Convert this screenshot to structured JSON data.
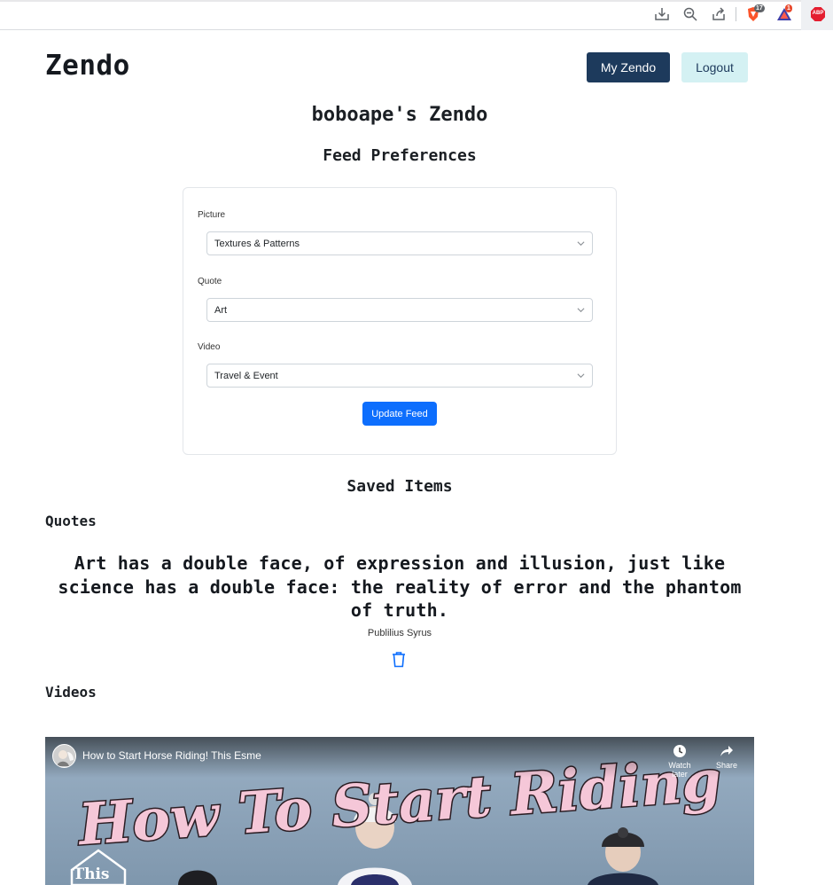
{
  "brand": "Zendo",
  "nav": {
    "my_zendo": "My Zendo",
    "logout": "Logout"
  },
  "user_title": "boboape's Zendo",
  "feed_preferences": {
    "title": "Feed Preferences",
    "picture": {
      "label": "Picture",
      "value": "Textures & Patterns"
    },
    "quote": {
      "label": "Quote",
      "value": "Art"
    },
    "video": {
      "label": "Video",
      "value": "Travel & Event"
    },
    "update_button": "Update Feed"
  },
  "saved": {
    "title": "Saved Items",
    "quotes_heading": "Quotes",
    "quote_text": "Art has a double face, of expression and illusion, just like science has a double face: the reality of error and the phantom of truth.",
    "quote_author": "Publilius Syrus",
    "videos_heading": "Videos",
    "video_title": "How to Start Horse Riding! This Esme",
    "watch_later": "Watch later",
    "share": "Share",
    "thumbnail_text": "How To Start Riding",
    "thumbnail_badge": "This"
  },
  "extensions": {
    "brave_count": "17",
    "rewards_count": "1",
    "abp": "ABP"
  },
  "icons": [
    "download-icon",
    "zoom-out-icon",
    "share-icon",
    "brave-shield-icon",
    "brave-rewards-icon",
    "adblock-plus-icon",
    "trash-icon",
    "chevron-down-icon",
    "clock-icon",
    "share-arrow-icon"
  ],
  "colors": {
    "primary_dark": "#1d3a5c",
    "logout_bg": "#d4f1f3",
    "update_blue": "#0d6efd",
    "trash_blue": "#0d6efd"
  }
}
